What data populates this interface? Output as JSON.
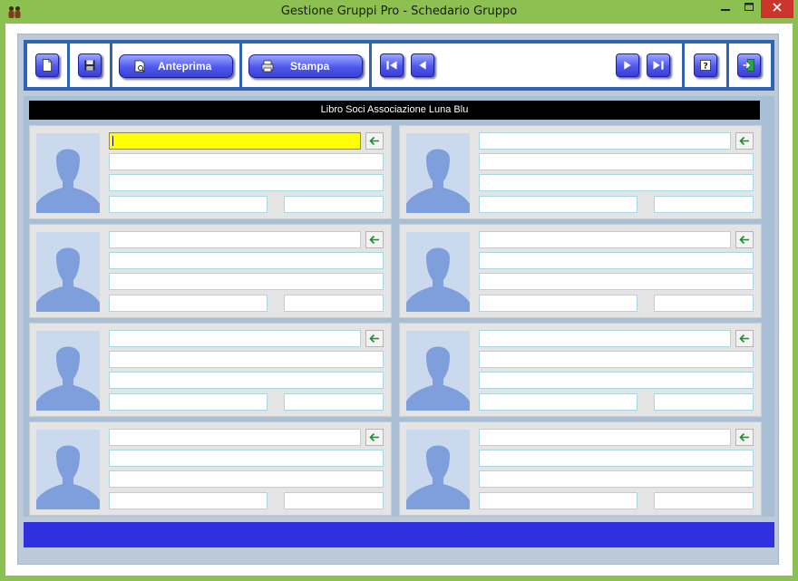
{
  "window": {
    "title": "Gestione Gruppi Pro - Schedario Gruppo",
    "minimize_icon": "minimize-icon",
    "maximize_icon": "maximize-icon",
    "close_icon": "close-icon",
    "close_color": "#c9342b",
    "frame_color": "#8cc152"
  },
  "toolbar": {
    "buttons": [
      {
        "name": "new-button",
        "icon": "new-document-icon"
      },
      {
        "name": "save-button",
        "icon": "floppy-disk-icon"
      },
      {
        "name": "preview-button",
        "icon": "print-preview-icon",
        "label": "Anteprima"
      },
      {
        "name": "print-button",
        "icon": "printer-icon",
        "label": "Stampa"
      },
      {
        "name": "first-button",
        "icon": "first-record-icon"
      },
      {
        "name": "prev-button",
        "icon": "previous-record-icon"
      },
      {
        "name": "next-button",
        "icon": "next-record-icon"
      },
      {
        "name": "last-button",
        "icon": "last-record-icon"
      },
      {
        "name": "help-button",
        "icon": "help-icon"
      },
      {
        "name": "exit-button",
        "icon": "exit-door-icon"
      }
    ],
    "button_color": "#4f58ee"
  },
  "panel": {
    "header": "Libro Soci Associazione Luna Blu",
    "cards": [
      {
        "name": "card-1",
        "fields": [
          "",
          "",
          "",
          "",
          ""
        ],
        "active": true
      },
      {
        "name": "card-2",
        "fields": [
          "",
          "",
          "",
          "",
          ""
        ]
      },
      {
        "name": "card-3",
        "fields": [
          "",
          "",
          "",
          "",
          ""
        ]
      },
      {
        "name": "card-4",
        "fields": [
          "",
          "",
          "",
          "",
          ""
        ]
      },
      {
        "name": "card-5",
        "fields": [
          "",
          "",
          "",
          "",
          ""
        ]
      },
      {
        "name": "card-6",
        "fields": [
          "",
          "",
          "",
          "",
          ""
        ]
      },
      {
        "name": "card-7",
        "fields": [
          "",
          "",
          "",
          "",
          ""
        ]
      },
      {
        "name": "card-8",
        "fields": [
          "",
          "",
          "",
          "",
          ""
        ]
      }
    ],
    "avatar_icon": "person-silhouette-icon",
    "arrow_icon": "arrow-left-icon",
    "highlight_color": "#ffff00"
  },
  "status": {
    "text": "",
    "color": "#3030de"
  }
}
